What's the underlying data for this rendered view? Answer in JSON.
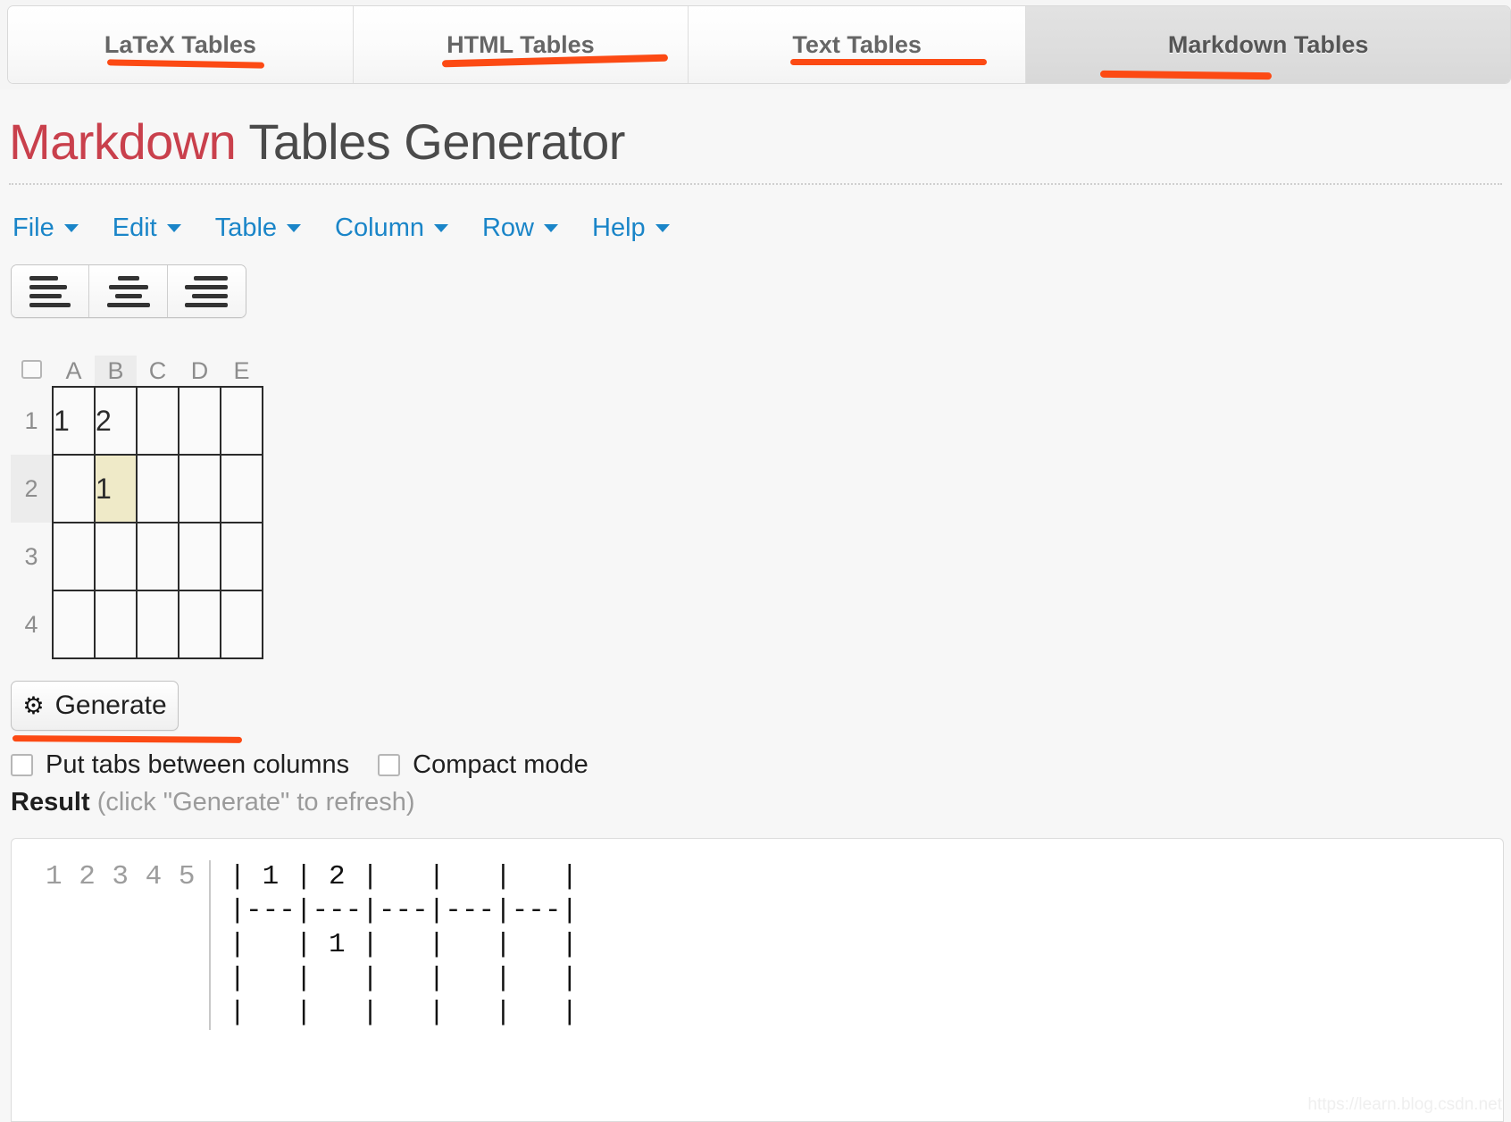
{
  "tabs": [
    {
      "label": "LaTeX Tables",
      "active": false
    },
    {
      "label": "HTML Tables",
      "active": false
    },
    {
      "label": "Text Tables",
      "active": false
    },
    {
      "label": "Markdown Tables",
      "active": true
    }
  ],
  "header": {
    "title_accent": "Markdown",
    "title_rest": " Tables Generator"
  },
  "menubar": {
    "items": [
      {
        "label": "File"
      },
      {
        "label": "Edit"
      },
      {
        "label": "Table"
      },
      {
        "label": "Column"
      },
      {
        "label": "Row"
      },
      {
        "label": "Help"
      }
    ]
  },
  "toolbar": {
    "align_buttons": [
      {
        "name": "align-left",
        "title": "Align left"
      },
      {
        "name": "align-center",
        "title": "Align center"
      },
      {
        "name": "align-right",
        "title": "Align right"
      }
    ]
  },
  "sheet": {
    "column_headers": [
      "A",
      "B",
      "C",
      "D",
      "E"
    ],
    "highlighted_column": "B",
    "row_headers": [
      "1",
      "2",
      "3",
      "4"
    ],
    "highlighted_row": "2",
    "active_cell": "B2",
    "rows": [
      [
        "1",
        "2",
        "",
        "",
        ""
      ],
      [
        "",
        "1",
        "",
        "",
        ""
      ],
      [
        "",
        "",
        "",
        "",
        ""
      ],
      [
        "",
        "",
        "",
        "",
        ""
      ]
    ]
  },
  "actions": {
    "generate_label": "Generate",
    "generate_icon": "gears-icon"
  },
  "options": [
    {
      "label": "Put tabs between columns",
      "checked": false
    },
    {
      "label": "Compact mode",
      "checked": false
    }
  ],
  "result": {
    "label": "Result",
    "hint": "(click \"Generate\" to refresh)",
    "line_numbers": "1\n2\n3\n4\n5",
    "code": "| 1 | 2 |   |   |   |\n|---|---|---|---|---|\n|   | 1 |   |   |   |\n|   |   |   |   |   |\n|   |   |   |   |   |"
  },
  "watermark": "https://learn.blog.csdn.net",
  "colors": {
    "accent_red": "#c9404c",
    "link_blue": "#1a85c8",
    "marker_orange": "#fc4a14",
    "active_cell": "#efeac8",
    "page_bg": "#f7f7f7"
  }
}
